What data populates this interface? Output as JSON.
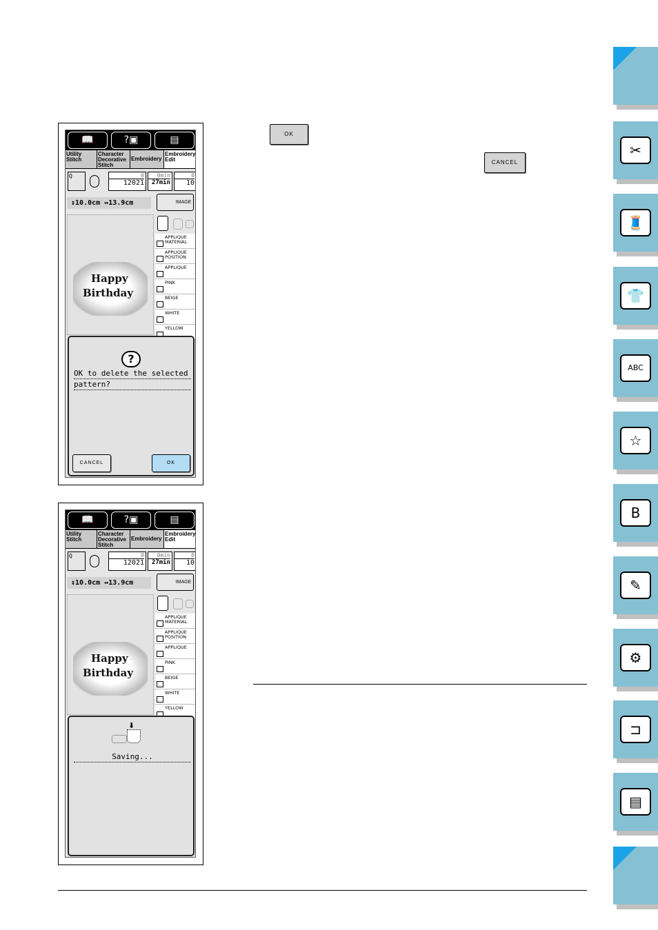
{
  "instructions": {
    "ok_button": "OK",
    "cancel_button": "CANCEL"
  },
  "screens": [
    {
      "tabs": [
        "Utility Stitch",
        "Character Decorative Stitch",
        "Embroidery",
        "Embroidery Edit"
      ],
      "stitch_count": "0",
      "stitch_total": "12021",
      "time_elapsed": "0min",
      "time_total": "27min",
      "color_current": "0",
      "color_total": "10",
      "height": "10.0cm",
      "width": "13.9cm",
      "image_button": "IMAGE",
      "pattern_line1": "Happy",
      "pattern_line2": "Birthday",
      "colors": [
        "APPLIQUE MATERIAL",
        "APPLIQUE POSITION",
        "APPLIQUE",
        "PINK",
        "BEIGE",
        "WHITE",
        "YELLOW"
      ],
      "dialog": {
        "icon": "question-icon",
        "message_line1": "OK to delete the selected",
        "message_line2": "pattern?",
        "cancel": "CANCEL",
        "ok": "OK"
      }
    },
    {
      "tabs": [
        "Utility Stitch",
        "Character Decorative Stitch",
        "Embroidery",
        "Embroidery Edit"
      ],
      "stitch_count": "0",
      "stitch_total": "12021",
      "time_elapsed": "0min",
      "time_total": "27min",
      "color_current": "0",
      "color_total": "10",
      "height": "10.0cm",
      "width": "13.9cm",
      "image_button": "IMAGE",
      "pattern_line1": "Happy",
      "pattern_line2": "Birthday",
      "colors": [
        "APPLIQUE MATERIAL",
        "APPLIQUE POSITION",
        "APPLIQUE",
        "PINK",
        "BEIGE",
        "WHITE",
        "YELLOW"
      ],
      "dialog": {
        "icon": "saving-pocket-icon",
        "message_line1": "Saving..."
      }
    }
  ],
  "sidebar": {
    "accent": "#1aa3e6",
    "tab_color": "#86c0d3",
    "tabs": [
      "blank",
      "sewing-machine-icon",
      "thread-spool-icon",
      "shirt-icon",
      "abc-shirt-icon",
      "embroidery-frame-icon",
      "monogram-shirt-icon",
      "edit-shirt-icon",
      "machine-settings-icon",
      "machine-icon",
      "document-pages-icon",
      "blank"
    ]
  }
}
